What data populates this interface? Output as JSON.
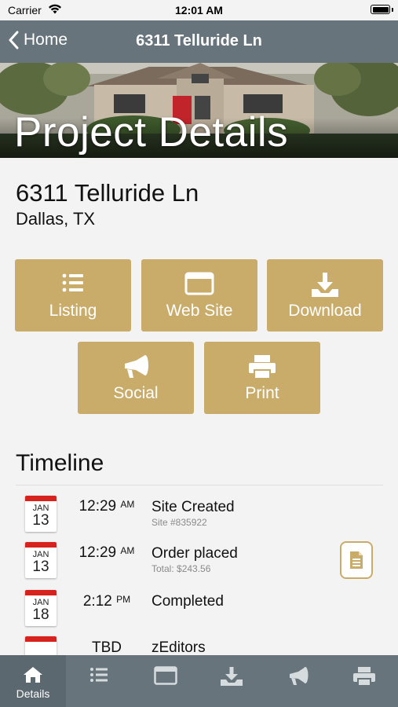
{
  "status_bar": {
    "carrier": "Carrier",
    "time": "12:01 AM"
  },
  "nav": {
    "back_label": "Home",
    "title": "6311 Telluride Ln"
  },
  "hero": {
    "title": "Project Details"
  },
  "address": {
    "line1": "6311 Telluride Ln",
    "line2": "Dallas, TX"
  },
  "actions": [
    {
      "label": "Listing",
      "icon": "list-icon"
    },
    {
      "label": "Web Site",
      "icon": "browser-window-icon"
    },
    {
      "label": "Download",
      "icon": "download-icon"
    },
    {
      "label": "Social",
      "icon": "megaphone-icon"
    },
    {
      "label": "Print",
      "icon": "printer-icon"
    }
  ],
  "timeline": {
    "title": "Timeline",
    "items": [
      {
        "month": "JAN",
        "day": "13",
        "time": "12:29",
        "ampm": "AM",
        "event": "Site Created",
        "detail": "Site #835922"
      },
      {
        "month": "JAN",
        "day": "13",
        "time": "12:29",
        "ampm": "AM",
        "event": "Order placed",
        "detail": "Total: $243.56"
      },
      {
        "month": "JAN",
        "day": "18",
        "time": "2:12",
        "ampm": "PM",
        "event": "Completed",
        "detail": ""
      },
      {
        "month": "",
        "day": "",
        "time": "TBD",
        "ampm": "",
        "event": "zEditors",
        "detail": ""
      }
    ]
  },
  "tabbar": {
    "active": "Details",
    "tabs": [
      {
        "label": "Details",
        "icon": "home-icon"
      },
      {
        "label": "",
        "icon": "list-icon"
      },
      {
        "label": "",
        "icon": "browser-window-icon"
      },
      {
        "label": "",
        "icon": "download-icon"
      },
      {
        "label": "",
        "icon": "megaphone-icon"
      },
      {
        "label": "",
        "icon": "printer-icon"
      }
    ]
  },
  "colors": {
    "accent_gold": "#c9ac6a",
    "nav_gray": "#67747c",
    "calendar_red": "#d8221e",
    "background": "#f3f3f3"
  }
}
